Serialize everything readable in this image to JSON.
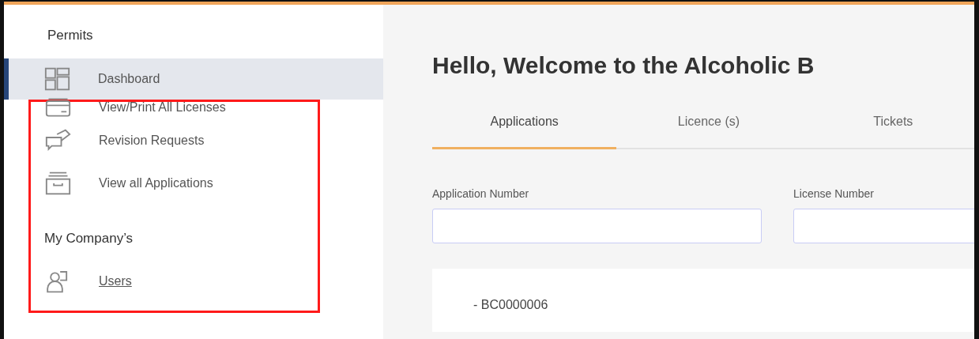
{
  "sidebar": {
    "heading": "Permits",
    "items": [
      {
        "kind": "link",
        "label": "Dashboard",
        "selected": true,
        "highlighted": false
      },
      {
        "kind": "link",
        "label": "View/Print All Licenses",
        "selected": false,
        "highlighted": true
      },
      {
        "kind": "link",
        "label": "Revision Requests",
        "selected": false,
        "highlighted": true
      },
      {
        "kind": "link",
        "label": "View all Applications",
        "selected": false,
        "highlighted": true
      },
      {
        "kind": "heading",
        "label": "My Company’s",
        "highlighted": true
      },
      {
        "kind": "link",
        "label": "Users",
        "selected": false,
        "underlined": true,
        "highlighted": true
      }
    ]
  },
  "main": {
    "title": "Hello, Welcome to the Alcoholic B",
    "tabs": [
      {
        "label": "Applications",
        "selected": true
      },
      {
        "label": "Licence (s)",
        "selected": false
      },
      {
        "label": "Tickets",
        "selected": false
      }
    ],
    "filters": [
      {
        "label": "Application Number"
      },
      {
        "label": "License Number"
      }
    ],
    "results": [
      {
        "text": "- BC0000006"
      }
    ]
  }
}
